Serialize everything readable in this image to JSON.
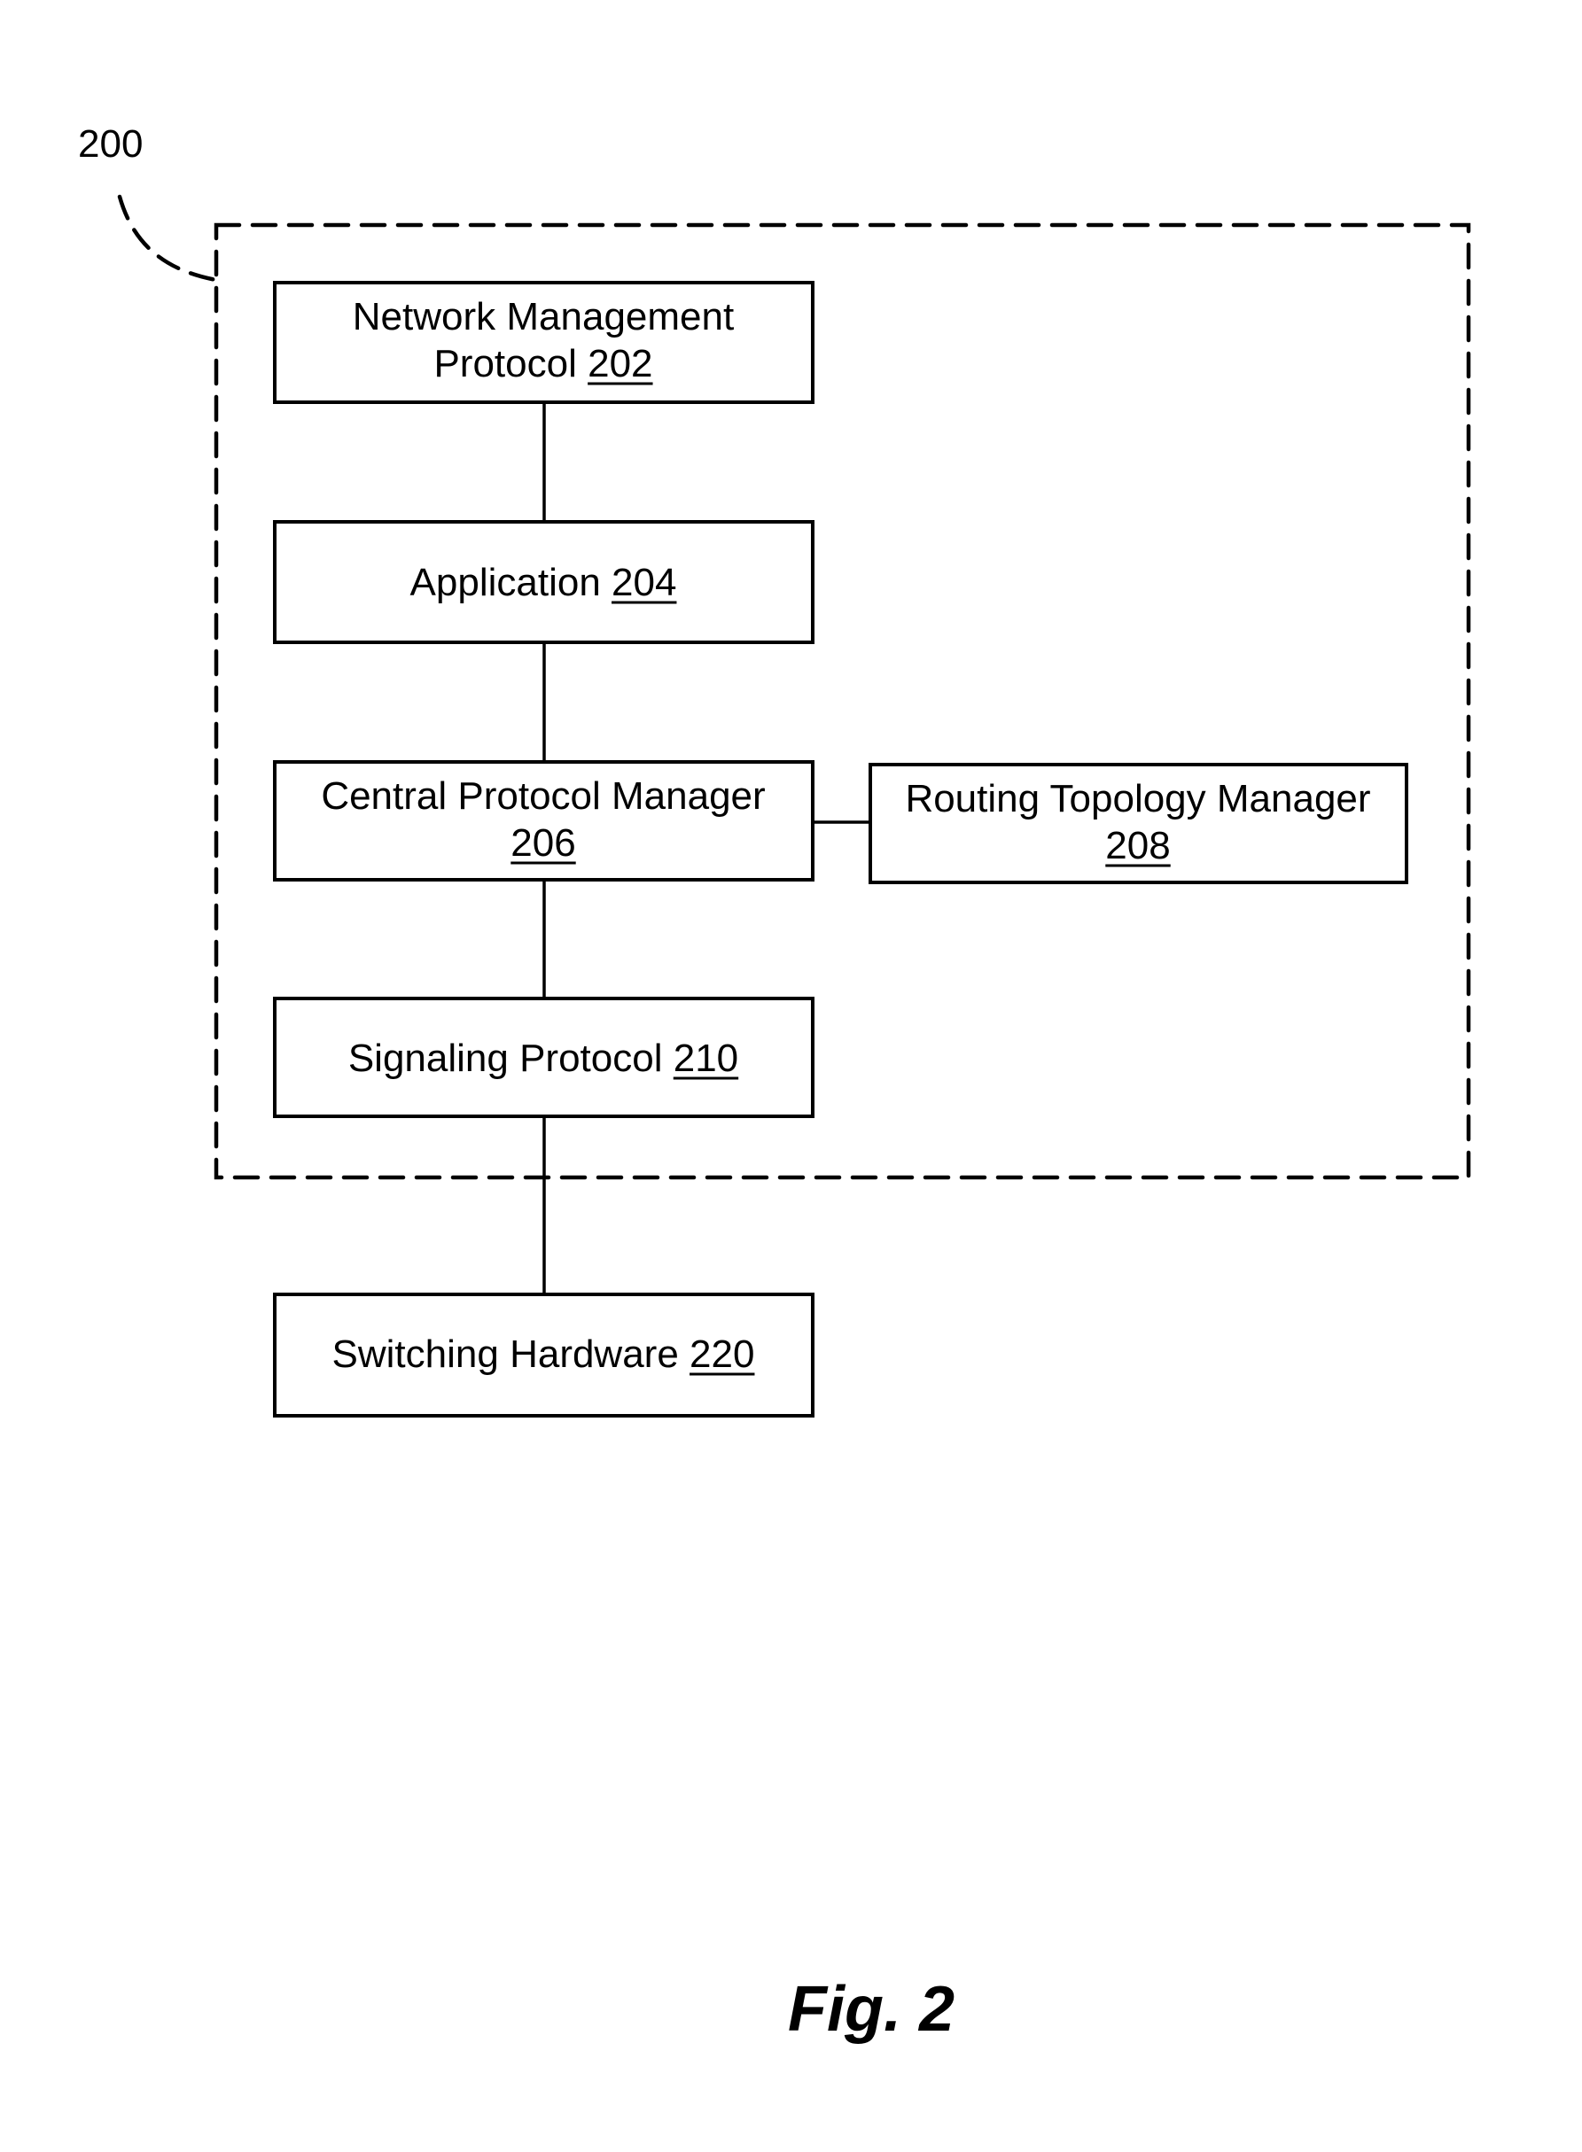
{
  "figure": {
    "reference_numeral": "200",
    "caption": "Fig. 2"
  },
  "blocks": [
    {
      "id": "202",
      "lines": [
        "Network Management",
        "Protocol"
      ],
      "ref": "202"
    },
    {
      "id": "204",
      "lines": [
        "Application"
      ],
      "ref": "204"
    },
    {
      "id": "206",
      "lines": [
        "Central Protocol Manager"
      ],
      "ref": "206",
      "ref_on_new_line": true
    },
    {
      "id": "208",
      "lines": [
        "Routing Topology Manager"
      ],
      "ref": "208",
      "ref_on_new_line": true
    },
    {
      "id": "210",
      "lines": [
        "Signaling Protocol"
      ],
      "ref": "210"
    },
    {
      "id": "220",
      "lines": [
        "Switching Hardware"
      ],
      "ref": "220"
    }
  ],
  "connections": [
    {
      "from": "202",
      "to": "204"
    },
    {
      "from": "204",
      "to": "206"
    },
    {
      "from": "206",
      "to": "208"
    },
    {
      "from": "206",
      "to": "210"
    },
    {
      "from": "210",
      "to": "220"
    }
  ],
  "group": {
    "label_ref": "200",
    "contains": [
      "202",
      "204",
      "206",
      "208",
      "210"
    ]
  }
}
